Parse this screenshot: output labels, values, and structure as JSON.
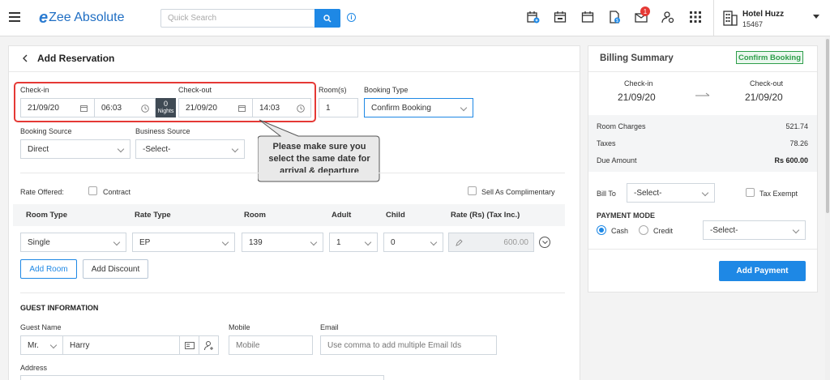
{
  "app": {
    "logo_e": "e",
    "logo_text": "Zee Absolute"
  },
  "search": {
    "placeholder": "Quick Search"
  },
  "topbar": {
    "mail_badge": "1",
    "hotel_name": "Hotel Huzz",
    "hotel_id": "15467"
  },
  "page": {
    "title": "Add Reservation"
  },
  "checkin": {
    "label": "Check-in",
    "date": "21/09/20",
    "time": "06:03"
  },
  "checkout": {
    "label": "Check-out",
    "date": "21/09/20",
    "time": "14:03"
  },
  "nights": {
    "count": "0",
    "label": "Nights"
  },
  "rooms": {
    "label": "Room(s)",
    "value": "1"
  },
  "booking_type": {
    "label": "Booking Type",
    "value": "Confirm Booking"
  },
  "booking_source": {
    "label": "Booking Source",
    "value": "Direct"
  },
  "business_source": {
    "label": "Business Source",
    "value": "-Select-"
  },
  "callout": {
    "text": "Please make sure you select the same date for arrival & departure"
  },
  "rate": {
    "offered_label": "Rate Offered:",
    "contract_label": "Contract",
    "complimentary_label": "Sell As Complimentary"
  },
  "table": {
    "headers": [
      "Room Type",
      "Rate Type",
      "Room",
      "Adult",
      "Child",
      "Rate (Rs)  (Tax Inc.)"
    ],
    "row": {
      "room_type": "Single",
      "rate_type": "EP",
      "room": "139",
      "adult": "1",
      "child": "0",
      "rate": "600.00"
    }
  },
  "buttons": {
    "add_room": "Add Room",
    "add_discount": "Add Discount",
    "add_payment": "Add Payment"
  },
  "guest": {
    "section_title": "GUEST INFORMATION",
    "name_label": "Guest Name",
    "salutation": "Mr.",
    "name": "Harry",
    "mobile_label": "Mobile",
    "mobile_placeholder": "Mobile",
    "email_label": "Email",
    "email_placeholder": "Use comma to add multiple Email Ids",
    "address_label": "Address"
  },
  "billing": {
    "title": "Billing Summary",
    "status": "Confirm Booking",
    "checkin_label": "Check-in",
    "checkin_date": "21/09/20",
    "checkout_label": "Check-out",
    "checkout_date": "21/09/20",
    "room_charges_label": "Room Charges",
    "room_charges": "521.74",
    "taxes_label": "Taxes",
    "taxes": "78.26",
    "due_label": "Due Amount",
    "due": "Rs 600.00",
    "bill_to_label": "Bill To",
    "bill_to_value": "-Select-",
    "tax_exempt_label": "Tax Exempt",
    "payment_mode_label": "PAYMENT MODE",
    "cash_label": "Cash",
    "credit_label": "Credit",
    "payment_select": "-Select-"
  },
  "colors": {
    "accent": "#1e88e5",
    "highlight": "#e53935",
    "success": "#2e9e4a",
    "callout_bg": "#e9e9e9"
  }
}
